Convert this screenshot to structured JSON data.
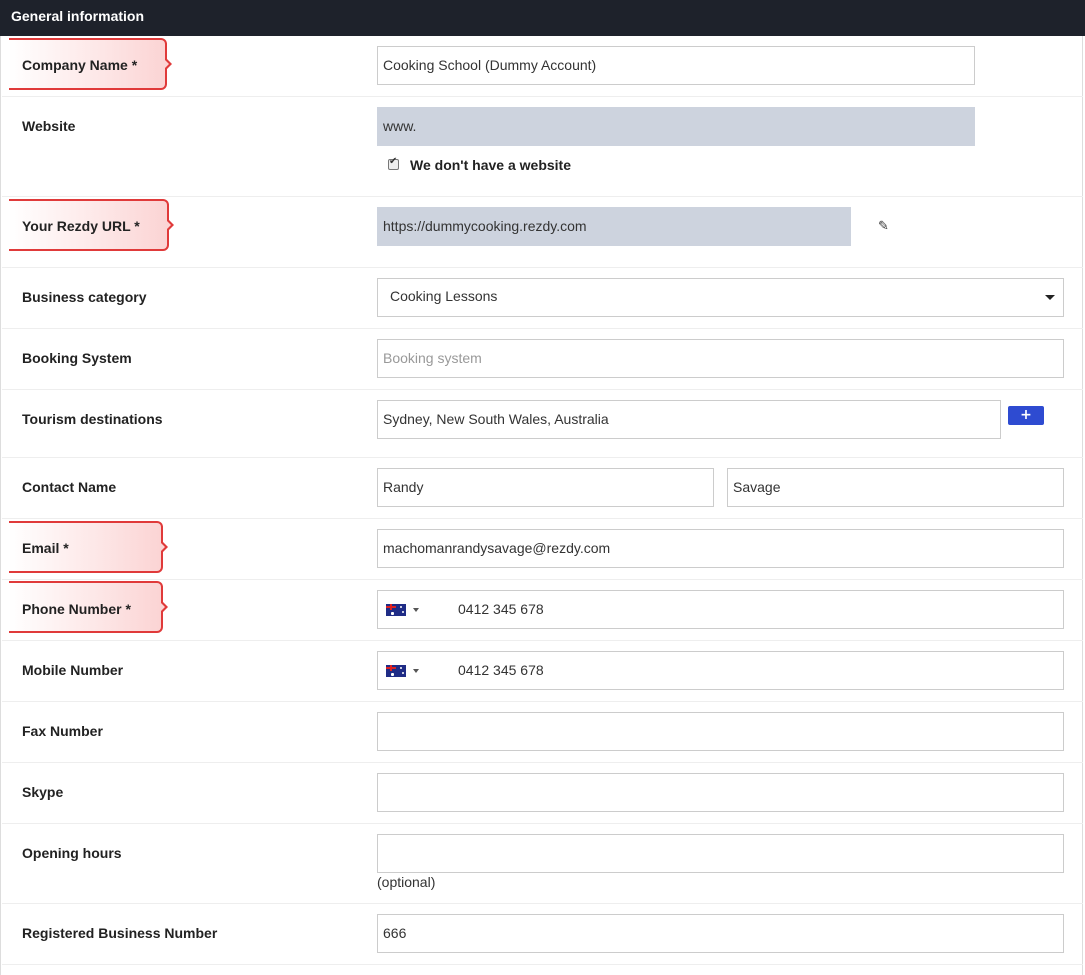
{
  "header": {
    "title": "General information"
  },
  "fields": {
    "company_name": {
      "label": "Company Name *",
      "value": "Cooking School (Dummy Account)"
    },
    "website": {
      "label": "Website",
      "value": "www.",
      "no_website_label": "We don't have a website",
      "no_website_checked": true
    },
    "rezdy_url": {
      "label": "Your Rezdy URL *",
      "value": "https://dummycooking.rezdy.com"
    },
    "business_category": {
      "label": "Business category",
      "value": "Cooking Lessons"
    },
    "booking_system": {
      "label": "Booking System",
      "placeholder": "Booking system"
    },
    "tourism_destinations": {
      "label": "Tourism destinations",
      "value": "Sydney, New South Wales, Australia",
      "add_label": "+"
    },
    "contact_name": {
      "label": "Contact Name",
      "first": "Randy",
      "last": "Savage"
    },
    "email": {
      "label": "Email *",
      "value": "machomanrandysavage@rezdy.com"
    },
    "phone_number": {
      "label": "Phone Number *",
      "value": "0412 345 678",
      "country": "AU"
    },
    "mobile_number": {
      "label": "Mobile Number",
      "value": "0412 345 678",
      "country": "AU"
    },
    "fax_number": {
      "label": "Fax Number",
      "value": ""
    },
    "skype": {
      "label": "Skype",
      "value": ""
    },
    "opening_hours": {
      "label": "Opening hours",
      "value": "",
      "note": "(optional)"
    },
    "registered_business_number": {
      "label": "Registered Business Number",
      "value": "666"
    }
  },
  "icons": {
    "edit": "edit-icon",
    "flag": "australia-flag-icon",
    "dropdown": "chevron-down-icon",
    "checkbox": "checkbox-checked-icon"
  },
  "colors": {
    "header_bg": "#1e222b",
    "disabled_bg": "#cdd3de",
    "highlight": "#e03a3a",
    "add_button": "#2e4bd1"
  }
}
